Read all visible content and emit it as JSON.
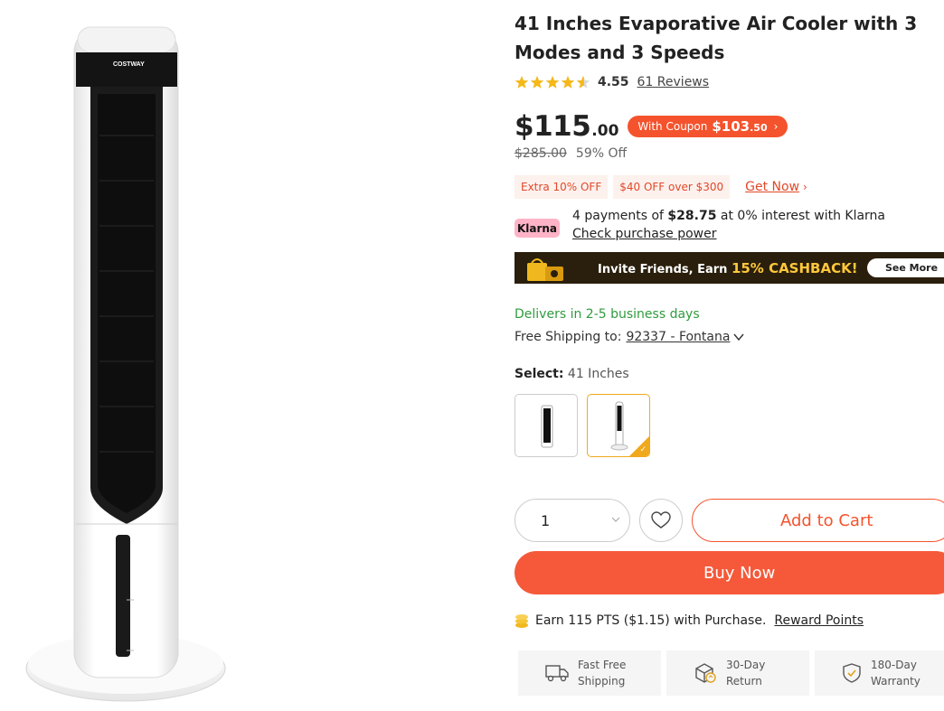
{
  "product": {
    "title": "41 Inches Evaporative Air Cooler with 3 Modes and 3 Speeds",
    "image_alt": "COSTWAY tower air cooler",
    "brand_logo": "COSTWAY"
  },
  "rating": {
    "value": "4.55",
    "stars": 4.55,
    "reviews_label": "61 Reviews"
  },
  "price": {
    "main": "$115",
    "cents": ".00",
    "coupon_prefix": "With Coupon",
    "coupon_price": "$103",
    "coupon_cents": ".50",
    "was": "$285.00",
    "discount": "59% Off"
  },
  "promos": {
    "tags": [
      "Extra 10% OFF",
      "$40 OFF over $300"
    ],
    "get_now": "Get Now"
  },
  "klarna": {
    "badge": "Klarna",
    "text_before": "4 payments of",
    "amount": "$28.75",
    "text_after": "at 0% interest with Klarna",
    "link": "Check purchase power"
  },
  "banner": {
    "text": "Invite Friends, Earn",
    "highlight": "15% CASHBACK!",
    "see_more": "See More"
  },
  "shipping": {
    "delivers": "Delivers in 2-5 business days",
    "label": "Free Shipping to:",
    "zip": "92337 - Fontana"
  },
  "select": {
    "label": "Select:",
    "value": "41 Inches"
  },
  "quantity": {
    "value": "1"
  },
  "actions": {
    "add_to_cart": "Add to Cart",
    "buy_now": "Buy Now"
  },
  "points": {
    "text": "Earn 115 PTS ($1.15) with Purchase.",
    "link": "Reward Points"
  },
  "benefits": [
    {
      "line1": "Fast Free",
      "line2": "Shipping",
      "icon": "truck-icon"
    },
    {
      "line1": "30-Day",
      "line2": "Return",
      "icon": "return-box-icon"
    },
    {
      "line1": "180-Day",
      "line2": "Warranty",
      "icon": "shield-check-icon"
    }
  ],
  "colors": {
    "accent": "#f4532d",
    "star": "#f5b818",
    "green": "#2f9b3d",
    "variant_selected": "#f0a81c"
  }
}
